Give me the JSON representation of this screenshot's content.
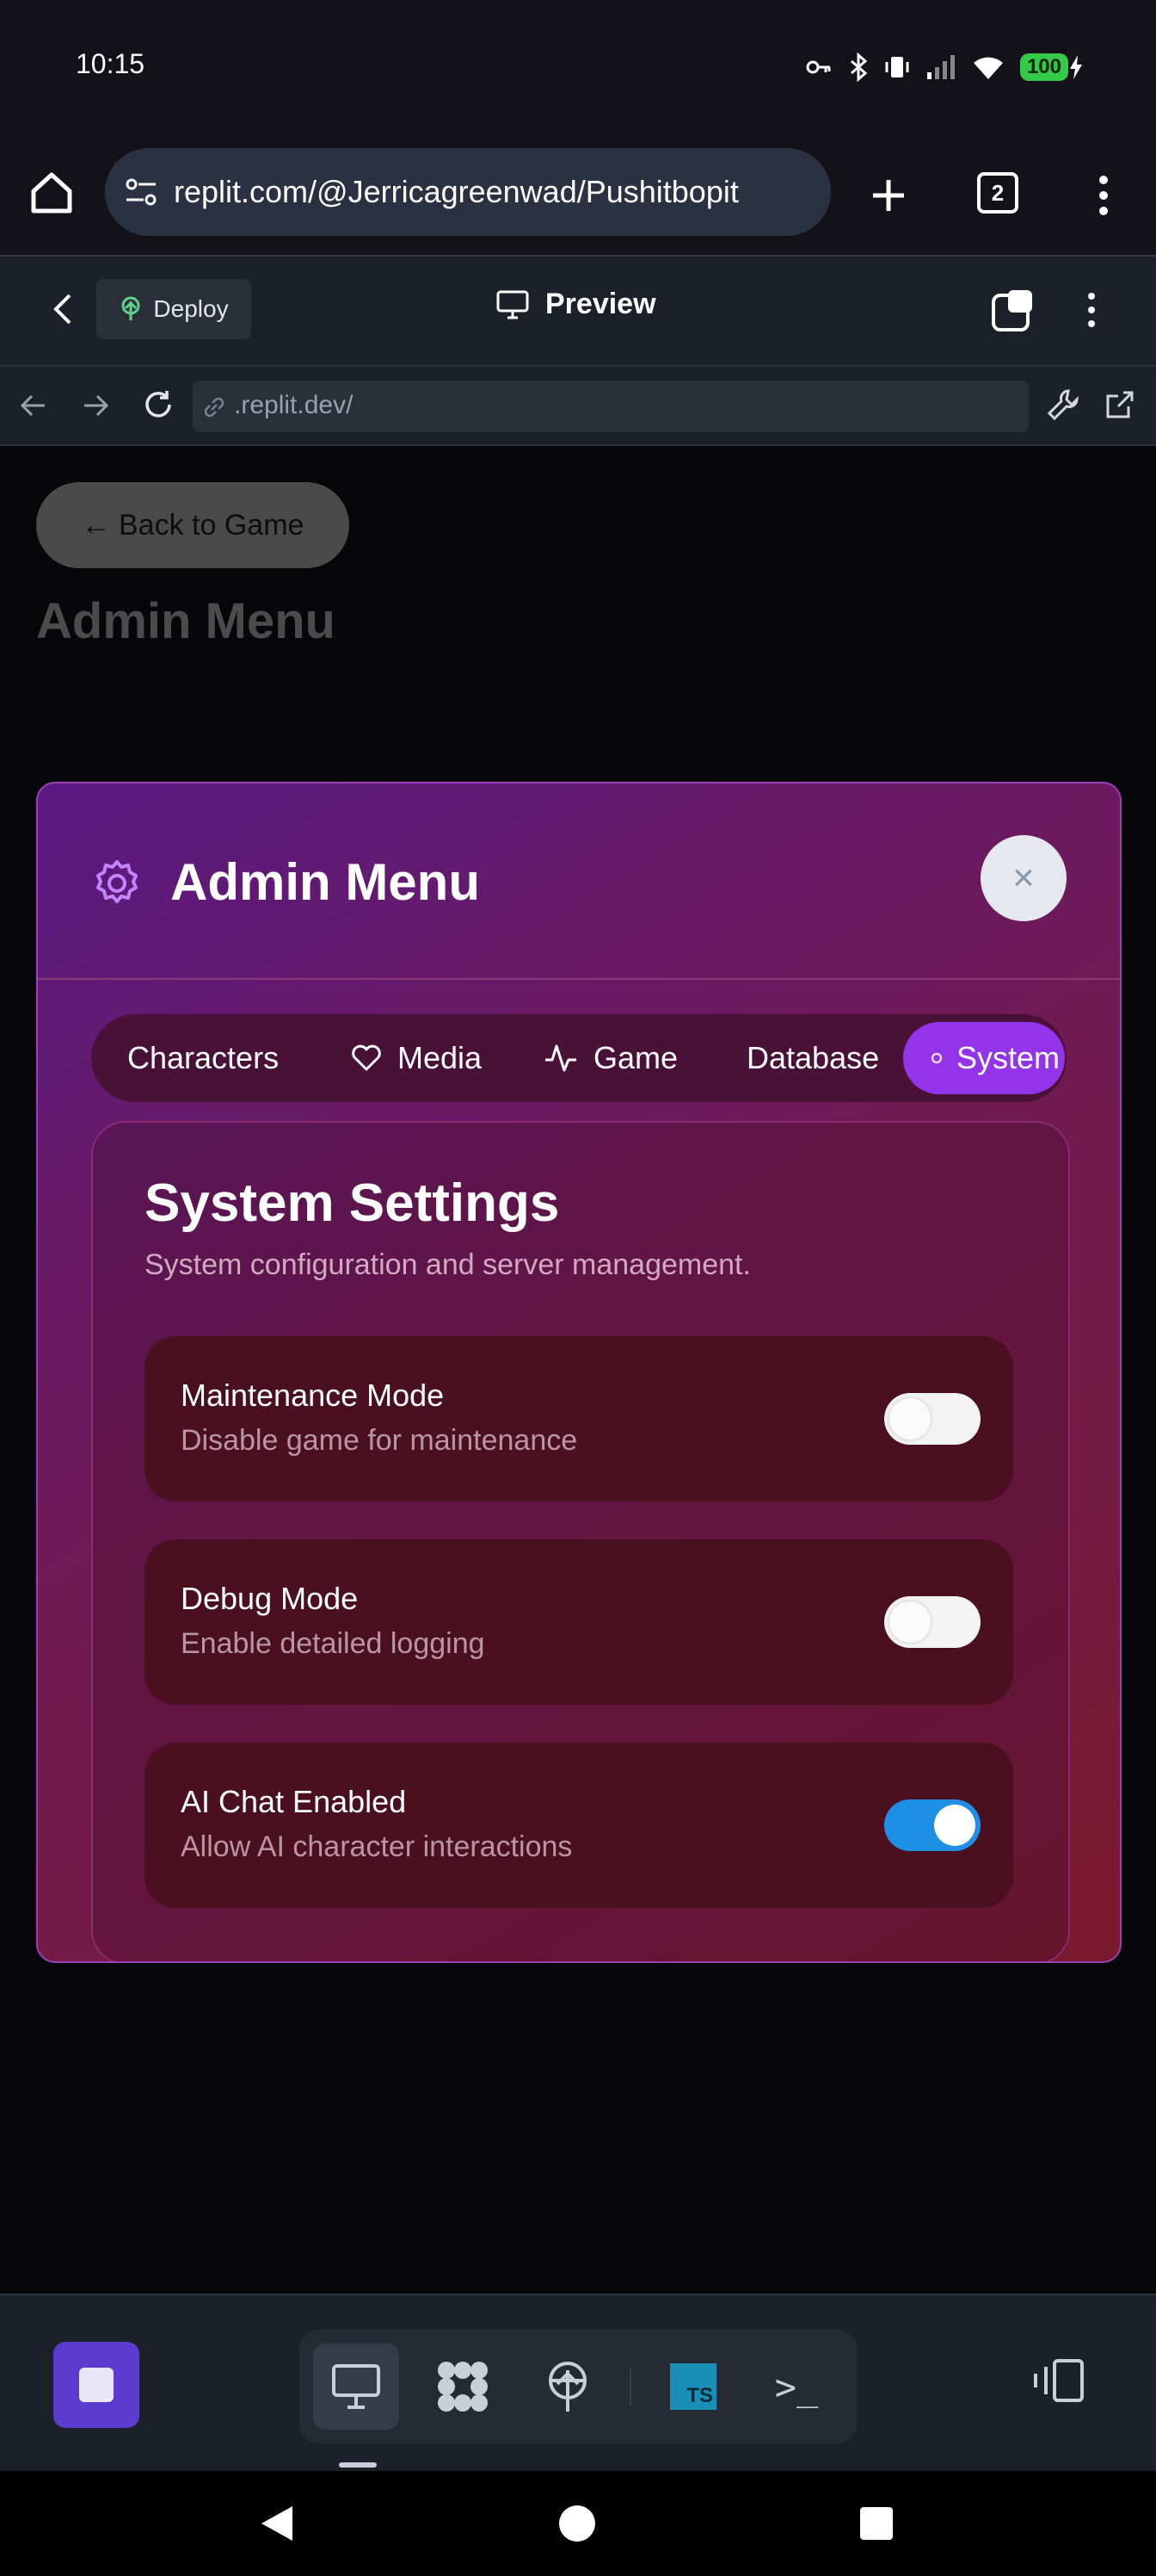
{
  "status": {
    "time": "10:15",
    "battery": "100"
  },
  "browser": {
    "url": "replit.com/@Jerricagreenwad/Pushitbopit",
    "tab_count": "2"
  },
  "replit": {
    "deploy_label": "Deploy",
    "preview_label": "Preview",
    "inner_url": ".replit.dev/"
  },
  "page": {
    "back_label": "← Back to Game",
    "heading": "Admin Menu"
  },
  "modal": {
    "title": "Admin Menu",
    "close_label": "×",
    "tabs": [
      {
        "label": "Characters",
        "icon": "none"
      },
      {
        "label": "Media",
        "icon": "heart-icon"
      },
      {
        "label": "Game",
        "icon": "activity-icon"
      },
      {
        "label": "Database",
        "icon": "none"
      },
      {
        "label": "System",
        "icon": "dot-icon",
        "active": true
      }
    ],
    "section_title": "System Settings",
    "section_desc": "System configuration and server management.",
    "settings": [
      {
        "label": "Maintenance Mode",
        "description": "Disable game for maintenance",
        "enabled": false
      },
      {
        "label": "Debug Mode",
        "description": "Enable detailed logging",
        "enabled": false
      },
      {
        "label": "AI Chat Enabled",
        "description": "Allow AI character interactions",
        "enabled": true
      }
    ]
  },
  "toolbar": {
    "ts_badge": "TS",
    "console_glyph": ">_"
  },
  "colors": {
    "accent": "#9333ea",
    "toggle_on": "#1f8fe6",
    "stop": "#5b3ccf"
  }
}
